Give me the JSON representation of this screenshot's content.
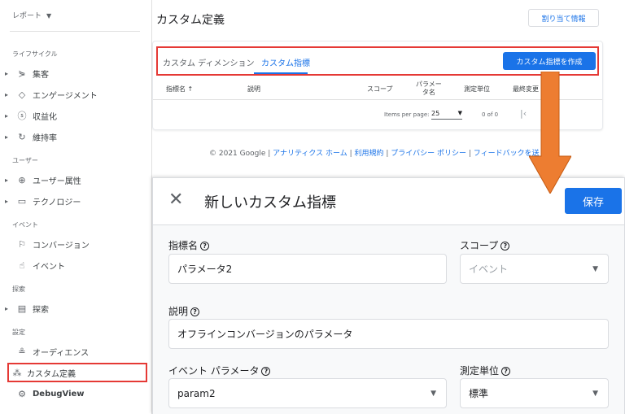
{
  "sidebar": {
    "top_label": "レポート",
    "sections": {
      "lifecycle": "ライフサイクル",
      "user": "ユーザー",
      "event": "イベント",
      "explore": "探索",
      "settings": "設定"
    },
    "items": [
      {
        "label": "集客",
        "icon": "acquisition-icon"
      },
      {
        "label": "エンゲージメント",
        "icon": "engagement-icon"
      },
      {
        "label": "収益化",
        "icon": "monetization-icon"
      },
      {
        "label": "維持率",
        "icon": "retention-icon"
      },
      {
        "label": "ユーザー属性",
        "icon": "demographics-icon"
      },
      {
        "label": "テクノロジー",
        "icon": "technology-icon"
      },
      {
        "label": "コンバージョン",
        "icon": "flag-icon"
      },
      {
        "label": "イベント",
        "icon": "touch-icon"
      },
      {
        "label": "探索",
        "icon": "explore-icon"
      },
      {
        "label": "オーディエンス",
        "icon": "audience-icon"
      },
      {
        "label": "カスタム定義",
        "icon": "custom-definition-icon"
      },
      {
        "label": "DebugView",
        "icon": "debug-icon"
      }
    ]
  },
  "header": {
    "title": "カスタム定義",
    "assign_button": "割り当て情報"
  },
  "tabs": {
    "dimension": "カスタム ディメンション",
    "metric": "カスタム指標",
    "create_button": "カスタム指標を作成"
  },
  "table": {
    "columns": [
      "指標名 ↑",
      "説明",
      "スコープ",
      "パラメータ名",
      "測定単位",
      "最終変更"
    ],
    "param_col_line1": "パラメー",
    "param_col_line2": "タ名"
  },
  "pager": {
    "items_per_page_label": "Items per page:",
    "items_per_page": "25",
    "range": "0 of 0"
  },
  "footer": {
    "copyright": "© 2021 Google |",
    "links": [
      "アナリティクス ホーム",
      "利用規約",
      "プライバシー ポリシー",
      "フィードバックを送"
    ]
  },
  "dialog": {
    "title": "新しいカスタム指標",
    "save_button": "保存",
    "metric_name_label": "指標名",
    "metric_name_value": "パラメータ2",
    "scope_label": "スコープ",
    "scope_value": "イベント",
    "description_label": "説明",
    "description_value": "オフラインコンバージョンのパラメータ",
    "event_param_label": "イベント パラメータ",
    "event_param_value": "param2",
    "unit_label": "測定単位",
    "unit_value": "標準"
  },
  "colors": {
    "accent": "#1a73e8",
    "highlight": "#e53935",
    "arrow": "#ed7d31"
  }
}
